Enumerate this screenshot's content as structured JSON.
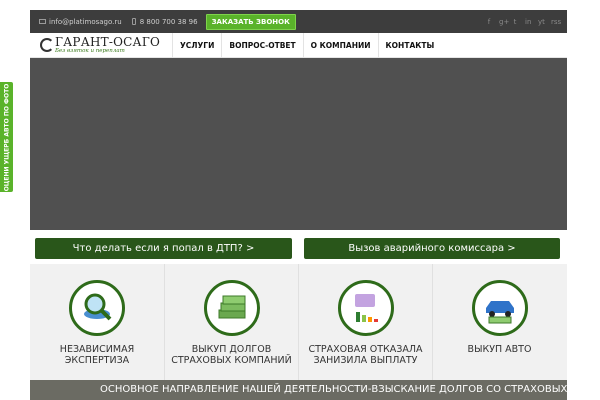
{
  "topbar": {
    "email": "info@platimosago.ru",
    "phone": "8 800 700 38 96",
    "callback_button": "ЗАКАЗАТЬ ЗВОНОК",
    "social": [
      "f",
      "g+",
      "t",
      "in",
      "yt",
      "rss"
    ]
  },
  "header": {
    "logo_title": "ГАРАНТ-ОСАГО",
    "logo_tagline": "Без взяток и переплат",
    "nav": [
      "УСЛУГИ",
      "ВОПРОС-ОТВЕТ",
      "О КОМПАНИИ",
      "КОНТАКТЫ"
    ]
  },
  "actions": {
    "left": "Что делать если я попал в ДТП? >",
    "right": "Вызов аварийного комиссара >"
  },
  "services": [
    {
      "label_line1": "НЕЗАВИСИМАЯ",
      "label_line2": "ЭКСПЕРТИЗА",
      "icon": "magnifier-car-icon"
    },
    {
      "label_line1": "ВЫКУП ДОЛГОВ",
      "label_line2": "СТРАХОВЫХ КОМПАНИЙ",
      "icon": "money-stack-icon"
    },
    {
      "label_line1": "СТРАХОВАЯ ОТКАЗАЛА",
      "label_line2": "ЗАНИЗИЛА ВЫПЛАТУ",
      "icon": "wallet-chart-icon"
    },
    {
      "label_line1": "ВЫКУП АВТО",
      "label_line2": "",
      "icon": "car-money-icon"
    }
  ],
  "banner": {
    "text": "ОСНОВНОЕ НАПРАВЛЕНИЕ НАШЕЙ ДЕЯТЕЛЬНОСТИ-ВЗЫСКАНИЕ ДОЛГОВ СО СТРАХОВЫХ КОМПАНИЙ"
  },
  "sidetab": {
    "label": "ОЦЕНИ УЩЕРБ АВТО ПО ФОТО"
  },
  "colors": {
    "accent_green": "#5ab32a",
    "dark_green": "#29561a",
    "topbar_bg": "#3d3d3d",
    "hero_bg": "#505050",
    "banner_bg": "#6b6b63"
  }
}
